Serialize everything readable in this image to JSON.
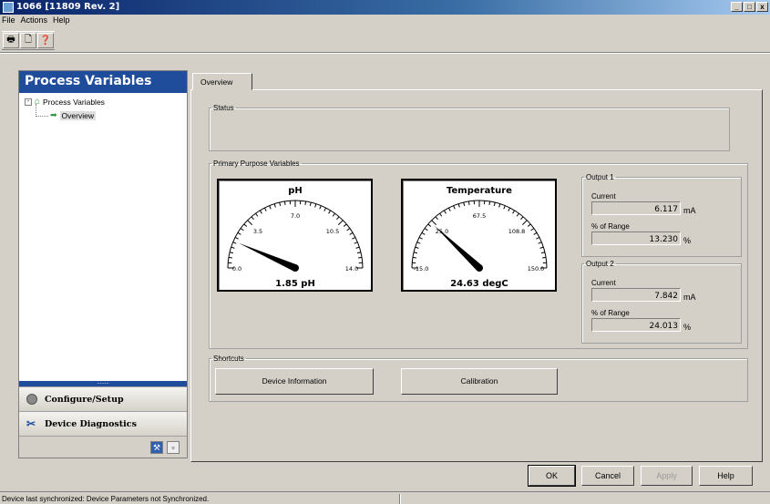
{
  "window": {
    "title": "1066 [11809 Rev. 2]",
    "min": "_",
    "max": "□",
    "close": "x"
  },
  "menu": [
    "File",
    "Actions",
    "Help"
  ],
  "toolbar": {
    "print": "🖶",
    "preview": "🗋",
    "help": "❓"
  },
  "left_panel": {
    "header": "Process Variables",
    "tree": {
      "root": "Process Variables",
      "child": "Overview",
      "expander": "-"
    },
    "nav": [
      {
        "label": "Configure/Setup",
        "icon": "gear-icon"
      },
      {
        "label": "Device Diagnostics",
        "icon": "tools-icon"
      }
    ],
    "grip": "........"
  },
  "tabs": {
    "overview": "Overview"
  },
  "status_group": {
    "legend": "Status"
  },
  "primary_group": {
    "legend": "Primary Purpose Variables"
  },
  "gauges": [
    {
      "title": "pH",
      "readout": "1.85 pH",
      "min": 0,
      "max": 14,
      "value": 1.85,
      "ticks": [
        "0.0",
        "3.5",
        "7.0",
        "10.5",
        "14.0"
      ]
    },
    {
      "title": "Temperature",
      "readout": "24.63 degC",
      "min": -15,
      "max": 150,
      "value": 24.63,
      "ticks": [
        "-15.0",
        "25.0",
        "67.5",
        "108.8",
        "150.0"
      ]
    }
  ],
  "outputs": [
    {
      "legend": "Output 1",
      "current_label": "Current",
      "current": "6.117",
      "current_unit": "mA",
      "range_label": "% of Range",
      "range": "13.230",
      "range_unit": "%"
    },
    {
      "legend": "Output 2",
      "current_label": "Current",
      "current": "7.842",
      "current_unit": "mA",
      "range_label": "% of Range",
      "range": "24.013",
      "range_unit": "%"
    }
  ],
  "shortcuts": {
    "legend": "Shortcuts",
    "device_info": "Device Information",
    "calibration": "Calibration"
  },
  "buttons": {
    "ok": "OK",
    "cancel": "Cancel",
    "apply": "Apply",
    "help": "Help"
  },
  "statusbar": {
    "text": "Device last synchronized: Device Parameters not Synchronized."
  }
}
